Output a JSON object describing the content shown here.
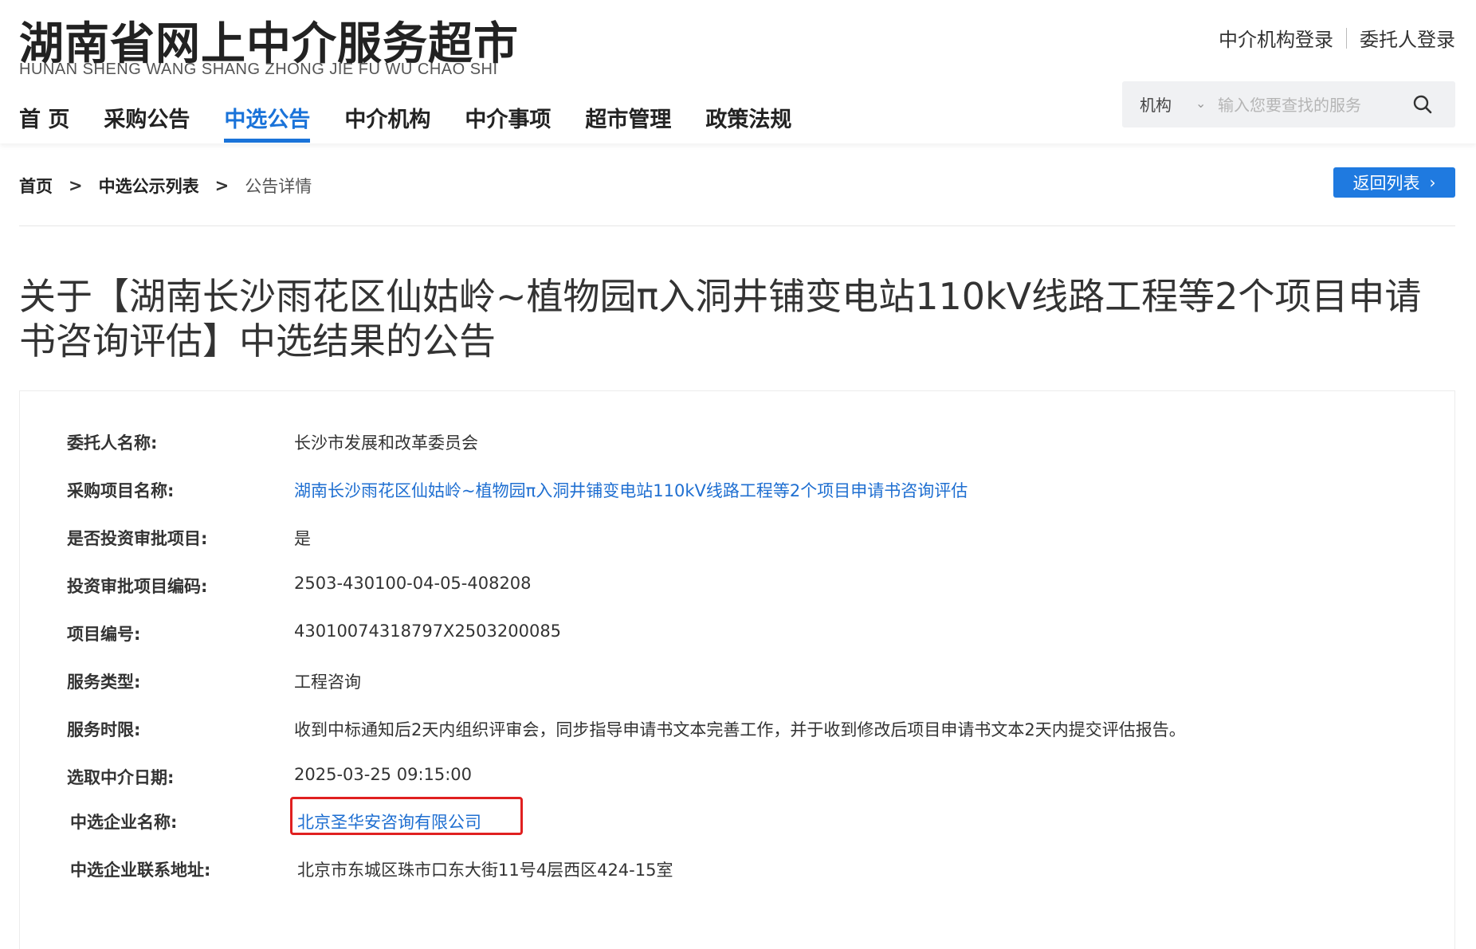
{
  "brand": {
    "cn": "湖南省网上中介服务超市",
    "en": "HUNAN SHENG WANG SHANG ZHONG JIE FU WU CHAO SHI"
  },
  "top_links": {
    "agency_login": "中介机构登录",
    "client_login": "委托人登录"
  },
  "nav": {
    "items": [
      "首 页",
      "采购公告",
      "中选公告",
      "中介机构",
      "中介事项",
      "超市管理",
      "政策法规"
    ],
    "active": "中选公告"
  },
  "search": {
    "category": "机构",
    "placeholder": "输入您要查找的服务"
  },
  "breadcrumb": {
    "home": "首页",
    "list": "中选公示列表",
    "sep": ">",
    "current": "公告详情"
  },
  "back_button": {
    "label": "返回列表"
  },
  "title": "关于【湖南长沙雨花区仙姑岭~植物园π入洞井铺变电站110kV线路工程等2个项目申请书咨询评估】中选结果的公告",
  "details": [
    {
      "label": "委托人名称:",
      "value": "长沙市发展和改革委员会"
    },
    {
      "label": "采购项目名称:",
      "value": "湖南长沙雨花区仙姑岭~植物园π入洞井铺变电站110kV线路工程等2个项目申请书咨询评估"
    },
    {
      "label": "是否投资审批项目:",
      "value": "是"
    },
    {
      "label": "投资审批项目编码:",
      "value": "2503-430100-04-05-408208"
    },
    {
      "label": "项目编号:",
      "value": "43010074318797X2503200085"
    },
    {
      "label": "服务类型:",
      "value": "工程咨询"
    },
    {
      "label": "服务时限:",
      "value": "收到中标通知后2天内组织评审会，同步指导申请书文本完善工作，并于收到修改后项目申请书文本2天内提交评估报告。"
    },
    {
      "label": "选取中介日期:",
      "value": "2025-03-25 09:15:00"
    },
    {
      "label": "中选企业名称:",
      "value": "北京圣华安咨询有限公司"
    },
    {
      "label": "中选企业联系地址:",
      "value": "北京市东城区珠市口东大街11号4层西区424-15室"
    }
  ],
  "colors": {
    "accent": "#1a73d9",
    "link": "#1f6fd1",
    "highlight": "#e02020"
  }
}
